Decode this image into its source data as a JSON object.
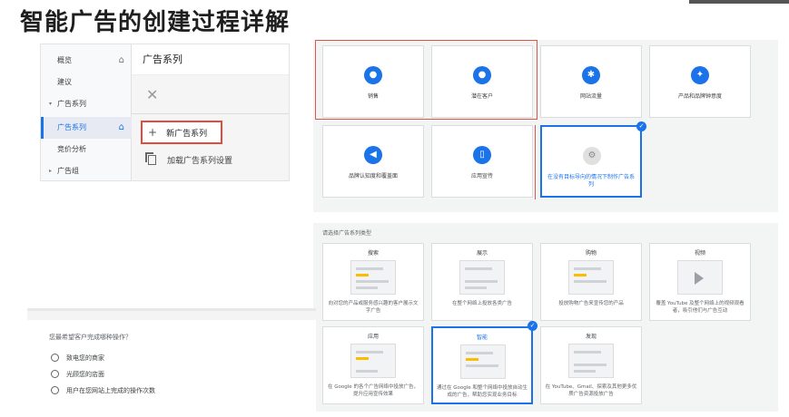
{
  "slide_title": "智能广告的创建过程详解",
  "sidebar": {
    "items": [
      {
        "label": "概览",
        "icon": "home-icon"
      },
      {
        "label": "建议"
      },
      {
        "label": "广告系列",
        "caret": "▾"
      },
      {
        "label": "广告系列",
        "icon": "home-icon",
        "active": true
      },
      {
        "label": "竞价分析"
      },
      {
        "label": "广告组",
        "caret": "▸"
      }
    ]
  },
  "campaigns_menu": {
    "header": "广告系列",
    "new_campaign": "新广告系列",
    "load_settings": "加载广告系列设置"
  },
  "goals": {
    "cards": [
      {
        "label": "销售",
        "icon": "tag-icon"
      },
      {
        "label": "潜在客户",
        "icon": "people-icon"
      },
      {
        "label": "网站流量",
        "icon": "cursor-click-icon"
      },
      {
        "label": "产品和品牌钟意度",
        "icon": "sparkle-icon"
      },
      {
        "label": "品牌认知度和覆盖面",
        "icon": "megaphone-icon"
      },
      {
        "label": "应用宣传",
        "icon": "phone-icon"
      },
      {
        "label": "在没有目标导向的情况下制作广告系列",
        "icon": "gear-icon",
        "selected": true
      }
    ]
  },
  "campaign_types": {
    "prompt": "请选择广告系列类型",
    "cards": [
      {
        "name": "搜索",
        "desc": "向对您的产品或服务感兴趣的客户展示文字广告"
      },
      {
        "name": "展示",
        "desc": "在整个网络上投放各类广告"
      },
      {
        "name": "购物",
        "desc": "投放购物广告来宣传您的产品"
      },
      {
        "name": "视频",
        "desc": "覆盖 YouTube 及整个网络上的视频观看者，吸引他们与广告互动"
      },
      {
        "name": "应用",
        "desc": "在 Google 的各个广告网络中投放广告，提升应用宣传效果"
      },
      {
        "name": "智能",
        "desc": "通过在 Google 和整个网络中投放自动生成的广告，帮助您实现业务目标",
        "selected": true
      },
      {
        "name": "发现",
        "desc": "在 YouTube、Gmail、探索及其他更多优质广告资源投放广告"
      }
    ]
  },
  "question": {
    "text": "您最希望客户完成哪种操作？",
    "options": [
      "致电您的商家",
      "光顾您的店面",
      "用户在您网站上完成的操作次数"
    ]
  },
  "colors": {
    "accent": "#1a73e8",
    "highlight_red": "#e54b3c",
    "panel_bg": "#f3f4f4"
  }
}
